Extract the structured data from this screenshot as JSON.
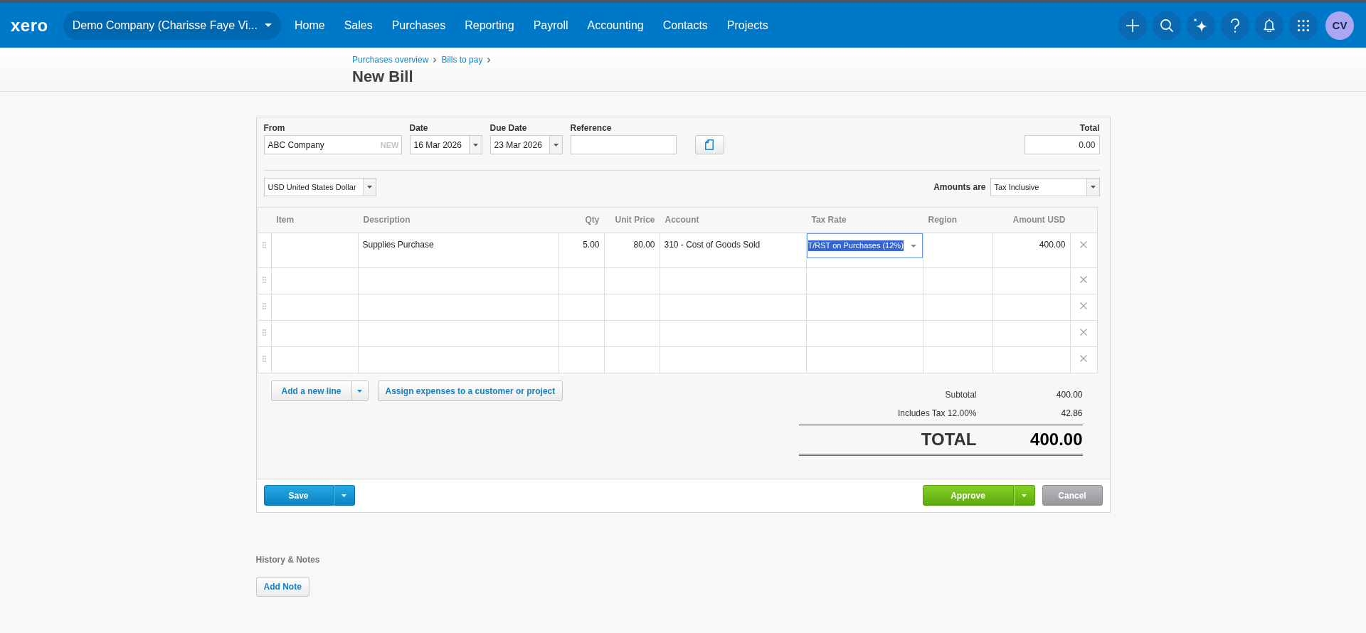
{
  "top_bar": {
    "logo": "xero",
    "organisation": "Demo Company (Charisse Faye Vi...",
    "nav": [
      "Home",
      "Sales",
      "Purchases",
      "Reporting",
      "Payroll",
      "Accounting",
      "Contacts",
      "Projects"
    ],
    "avatar": "CV"
  },
  "header": {
    "breadcrumbs": [
      "Purchases overview",
      "Bills to pay"
    ],
    "title": "New Bill"
  },
  "bill": {
    "fields": [
      {
        "kind": "contact",
        "label": "From",
        "value": "ABC Company",
        "tag": "NEW"
      },
      {
        "kind": "date",
        "label": "Date",
        "value": "16 Mar 2026"
      },
      {
        "kind": "date",
        "label": "Due Date",
        "value": "23 Mar 2026"
      },
      {
        "kind": "text",
        "label": "Reference"
      }
    ],
    "total": {
      "label": "Total",
      "value": "0.00"
    },
    "currency": "USD United States Dollar",
    "amounts_are": {
      "label": "Amounts are",
      "value": "Tax Inclusive"
    }
  },
  "line_items": {
    "columns": [
      {
        "label": "Item",
        "kind": "text"
      },
      {
        "label": "Description",
        "kind": "text"
      },
      {
        "label": "Qty",
        "kind": "number"
      },
      {
        "label": "Unit Price",
        "kind": "number"
      },
      {
        "label": "Account",
        "kind": "text"
      },
      {
        "label": "Tax Rate",
        "kind": "text"
      },
      {
        "label": "Region",
        "kind": "text"
      },
      {
        "label": "Amount USD",
        "kind": "number"
      }
    ],
    "rows": [
      {
        "description": "Supplies Purchase",
        "qty": "5.00",
        "unit_price": "80.00",
        "account": "310 - Cost of Goods Sold",
        "tax_rate": "T/RST on Purchases (12%)",
        "amount": "400.00",
        "editing": true
      },
      {
        "editing": false
      },
      {
        "editing": false
      },
      {
        "editing": false
      },
      {
        "editing": false
      }
    ]
  },
  "line_actions": {
    "add_line": "Add a new line",
    "assign": "Assign expenses to a customer or project"
  },
  "totals": {
    "lines": [
      {
        "label": "Subtotal",
        "value": "400.00"
      },
      {
        "label": "Includes Tax 12.00%",
        "value": "42.86"
      }
    ],
    "grand_total": {
      "label": "TOTAL",
      "value": "400.00"
    }
  },
  "actions": {
    "save": "Save",
    "approve": "Approve",
    "cancel": "Cancel"
  },
  "history": {
    "title": "History & Notes",
    "add_note": "Add Note"
  }
}
